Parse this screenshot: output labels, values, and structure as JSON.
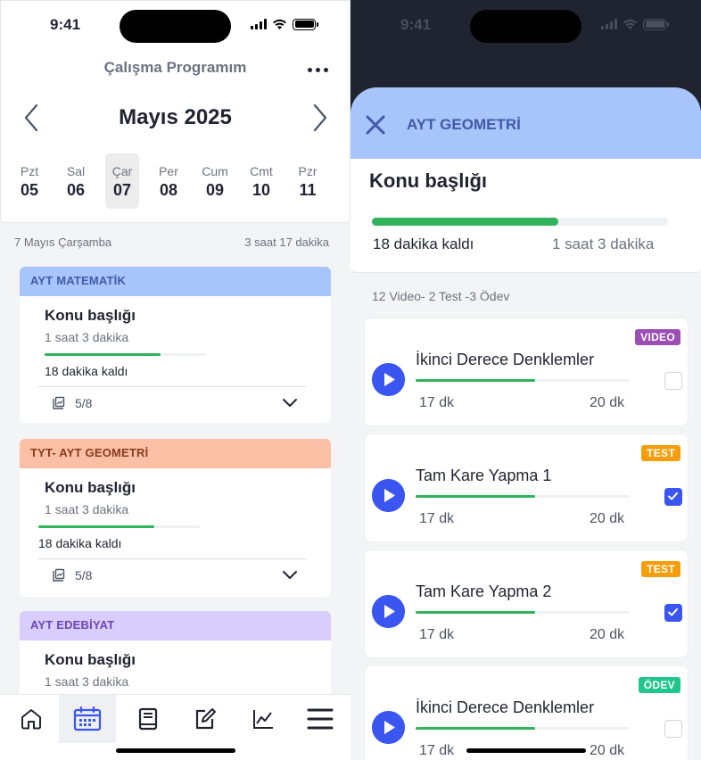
{
  "status": {
    "time": "9:41"
  },
  "left": {
    "app_title": "Çalışma Programım",
    "month": "Mayıs 2025",
    "days": [
      {
        "name": "Pzt",
        "num": "05",
        "selected": false
      },
      {
        "name": "Sal",
        "num": "06",
        "selected": false
      },
      {
        "name": "Çar",
        "num": "07",
        "selected": true
      },
      {
        "name": "Per",
        "num": "08",
        "selected": false
      },
      {
        "name": "Cum",
        "num": "09",
        "selected": false
      },
      {
        "name": "Cmt",
        "num": "10",
        "selected": false
      },
      {
        "name": "Pzr",
        "num": "11",
        "selected": false
      }
    ],
    "summary": {
      "date": "7 Mayıs Çarşamba",
      "total": "3 saat 17 dakika"
    },
    "cards": [
      {
        "subject": "AYT MATEMATİK",
        "header_bg": "#a7c4fb",
        "header_color": "#3f5ba8",
        "topic": "Konu başlığı",
        "duration": "1 saat 3 dakika",
        "progress": 0.72,
        "remaining": "18 dakika kaldı",
        "count": "5/8"
      },
      {
        "subject": "TYT- AYT GEOMETRİ",
        "header_bg": "#fbbfa6",
        "header_color": "#8a3b1c",
        "topic": "Konu başlığı",
        "duration": "1 saat 3 dakika",
        "progress": 0.72,
        "remaining": "18 dakika kaldı",
        "count": "5/8"
      },
      {
        "subject": "AYT EDEBİYAT",
        "header_bg": "#d8cdfb",
        "header_color": "#6a47b8",
        "topic": "Konu başlığı",
        "duration": "1 saat 3 dakika"
      }
    ],
    "tabs": [
      "home-icon",
      "calendar-icon",
      "book-icon",
      "edit-icon",
      "chart-icon",
      "menu-icon"
    ]
  },
  "right": {
    "subject": "AYT GEOMETRİ",
    "topic": "Konu başlığı",
    "progress": 0.63,
    "remaining": "18 dakika kaldı",
    "total": "1 saat 3 dakika",
    "counts": "12 Video- 2 Test -3 Ödev",
    "items": [
      {
        "badge": "VIDEO",
        "badge_color": "#9b4fb5",
        "title": "İkinci Derece Denklemler",
        "watched": "17 dk",
        "length": "20 dk",
        "progress": 0.56,
        "checked": false
      },
      {
        "badge": "TEST",
        "badge_color": "#f59e0b",
        "title": "Tam Kare Yapma 1",
        "watched": "17 dk",
        "length": "20 dk",
        "progress": 0.56,
        "checked": true
      },
      {
        "badge": "TEST",
        "badge_color": "#f59e0b",
        "title": "Tam Kare Yapma 2",
        "watched": "17 dk",
        "length": "20 dk",
        "progress": 0.56,
        "checked": true
      },
      {
        "badge": "ÖDEV",
        "badge_color": "#22c58b",
        "title": "İkinci Derece Denklemler",
        "watched": "17 dk",
        "length": "20 dk",
        "progress": 0.56,
        "checked": false
      }
    ]
  }
}
